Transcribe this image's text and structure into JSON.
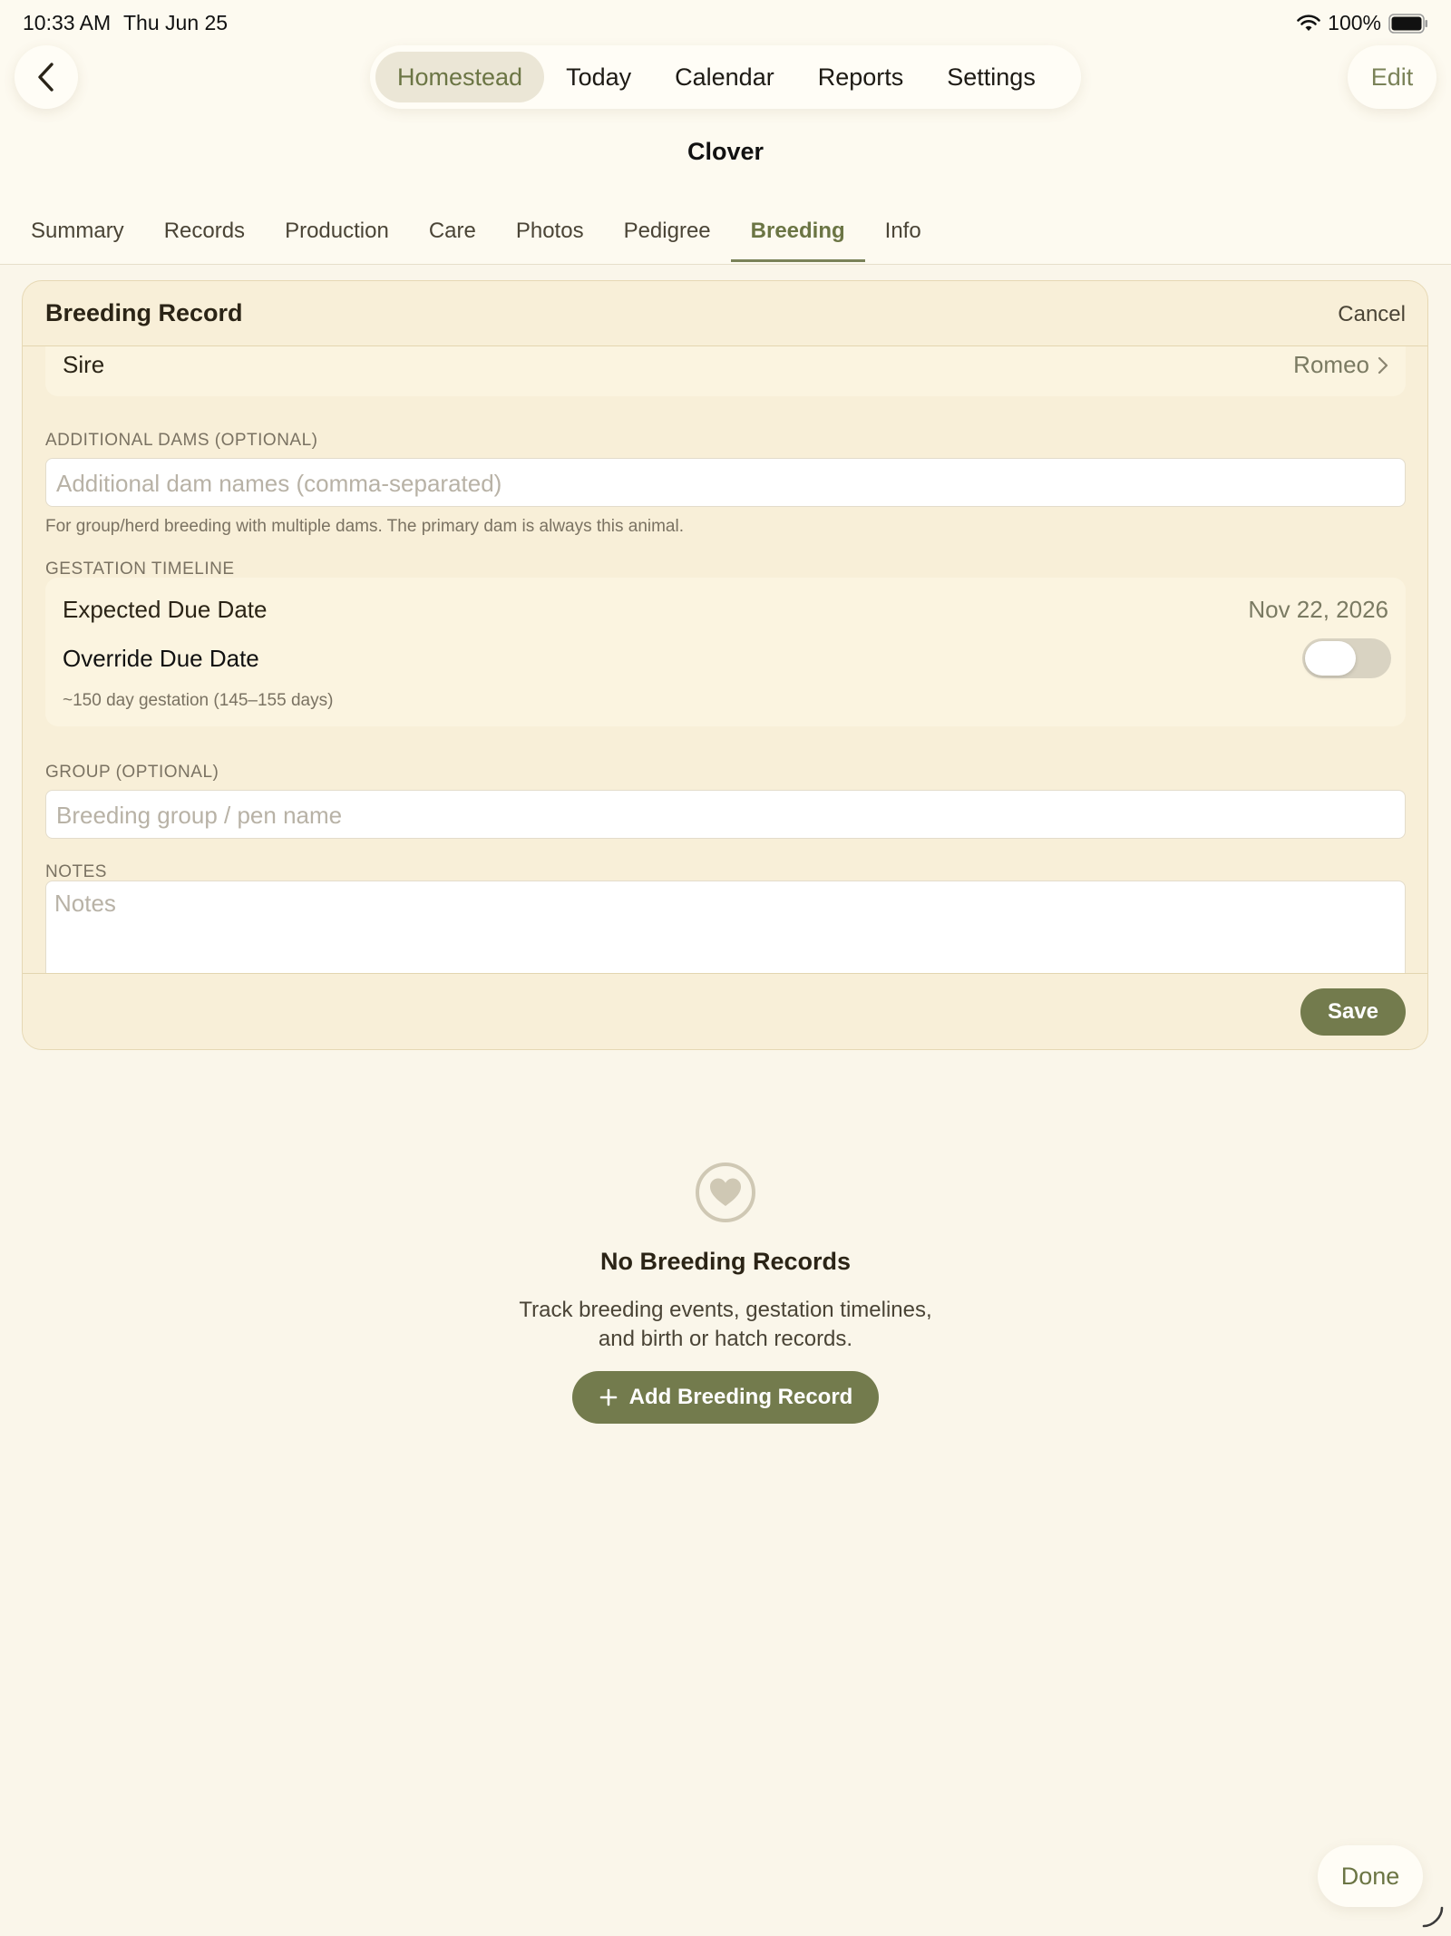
{
  "status_bar": {
    "time": "10:33 AM",
    "date": "Thu Jun 25",
    "battery": "100%"
  },
  "nav": {
    "segments": [
      "Homestead",
      "Today",
      "Calendar",
      "Reports",
      "Settings"
    ],
    "active_segment": "Homestead",
    "edit_label": "Edit",
    "back_icon": "chevron-left-icon"
  },
  "animal": {
    "name": "Clover"
  },
  "tabs": {
    "items": [
      "Summary",
      "Records",
      "Production",
      "Care",
      "Photos",
      "Pedigree",
      "Breeding",
      "Info"
    ],
    "active": "Breeding"
  },
  "breeding_form": {
    "title": "Breeding Record",
    "cancel_label": "Cancel",
    "sire_label": "Sire",
    "sire_value": "Romeo",
    "additional_dams_label": "ADDITIONAL DAMS (OPTIONAL)",
    "additional_dams_placeholder": "Additional dam names (comma-separated)",
    "additional_dams_helper": "For group/herd breeding with multiple dams. The primary dam is always this animal.",
    "gestation_label": "GESTATION TIMELINE",
    "expected_due_label": "Expected Due Date",
    "expected_due_value": "Nov 22, 2026",
    "override_label": "Override Due Date",
    "override_on": false,
    "gestation_helper": "~150 day gestation (145–155 days)",
    "group_label": "GROUP (OPTIONAL)",
    "group_placeholder": "Breeding group / pen name",
    "notes_label": "NOTES",
    "notes_placeholder": "Notes",
    "save_label": "Save"
  },
  "empty_state": {
    "icon": "heart-icon",
    "title": "No Breeding Records",
    "description_line1": "Track breeding events, gestation timelines,",
    "description_line2": "and birth or hatch records.",
    "add_label": "Add Breeding Record"
  },
  "done_label": "Done",
  "colors": {
    "accent": "#737b4d",
    "background": "#faf6ea",
    "card": "#f8efd8"
  }
}
